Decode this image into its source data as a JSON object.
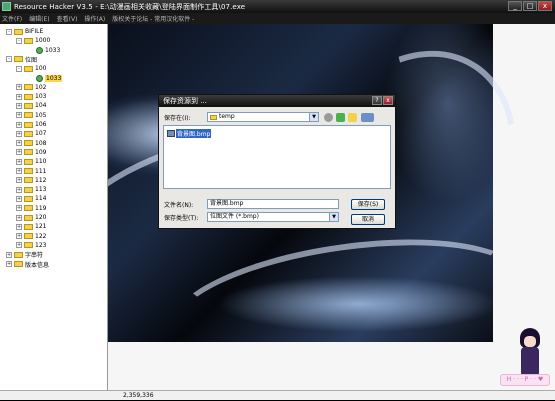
{
  "window": {
    "title": "Resource Hacker V3.5 - E:\\动漫画相关收藏\\登陆界面制作工具\\07.exe",
    "controls": [
      "_",
      "□",
      "x"
    ]
  },
  "menu": {
    "items": [
      "文件(F)",
      "编辑(E)",
      "查看(V)",
      "操作(A)",
      "版权关于论坛 - 常用汉化软件 -"
    ]
  },
  "tree": {
    "nodes": [
      {
        "label": "BIFILE",
        "level": 0,
        "exp": "-",
        "type": "folder"
      },
      {
        "label": "1000",
        "level": 1,
        "exp": "-",
        "type": "folder"
      },
      {
        "label": "1033",
        "level": 2,
        "exp": "",
        "type": "gear"
      },
      {
        "label": "位图",
        "level": 0,
        "exp": "-",
        "type": "folder"
      },
      {
        "label": "100",
        "level": 1,
        "exp": "-",
        "type": "folder"
      },
      {
        "label": "1033",
        "level": 2,
        "exp": "",
        "type": "gear",
        "selected": true
      },
      {
        "label": "102",
        "level": 1,
        "exp": "+",
        "type": "folder"
      },
      {
        "label": "103",
        "level": 1,
        "exp": "+",
        "type": "folder"
      },
      {
        "label": "104",
        "level": 1,
        "exp": "+",
        "type": "folder"
      },
      {
        "label": "105",
        "level": 1,
        "exp": "+",
        "type": "folder"
      },
      {
        "label": "106",
        "level": 1,
        "exp": "+",
        "type": "folder"
      },
      {
        "label": "107",
        "level": 1,
        "exp": "+",
        "type": "folder"
      },
      {
        "label": "108",
        "level": 1,
        "exp": "+",
        "type": "folder"
      },
      {
        "label": "109",
        "level": 1,
        "exp": "+",
        "type": "folder"
      },
      {
        "label": "110",
        "level": 1,
        "exp": "+",
        "type": "folder"
      },
      {
        "label": "111",
        "level": 1,
        "exp": "+",
        "type": "folder"
      },
      {
        "label": "112",
        "level": 1,
        "exp": "+",
        "type": "folder"
      },
      {
        "label": "113",
        "level": 1,
        "exp": "+",
        "type": "folder"
      },
      {
        "label": "114",
        "level": 1,
        "exp": "+",
        "type": "folder"
      },
      {
        "label": "119",
        "level": 1,
        "exp": "+",
        "type": "folder"
      },
      {
        "label": "120",
        "level": 1,
        "exp": "+",
        "type": "folder"
      },
      {
        "label": "121",
        "level": 1,
        "exp": "+",
        "type": "folder"
      },
      {
        "label": "122",
        "level": 1,
        "exp": "+",
        "type": "folder"
      },
      {
        "label": "123",
        "level": 1,
        "exp": "+",
        "type": "folder"
      },
      {
        "label": "字串符",
        "level": 0,
        "exp": "+",
        "type": "folder"
      },
      {
        "label": "版本信息",
        "level": 0,
        "exp": "+",
        "type": "folder"
      }
    ]
  },
  "dialog": {
    "title": "保存资源到 ...",
    "save_in_label": "保存在(I):",
    "save_in_value": "temp",
    "file_item": "背景图.bmp",
    "filename_label": "文件名(N):",
    "filename_value": "背景图.bmp",
    "filetype_label": "保存类型(T):",
    "filetype_value": "位图文件 (*.bmp)",
    "save_button": "保存(S)",
    "cancel_button": "取消",
    "title_buttons": [
      "?",
      "x"
    ]
  },
  "status": {
    "text": "2,359,336"
  },
  "badge": {
    "text": "H · · · P · · ♥"
  },
  "colors": {
    "selection": "#3166c5",
    "tree_highlight": "#ffd64a",
    "folder": "#f2d24a"
  }
}
